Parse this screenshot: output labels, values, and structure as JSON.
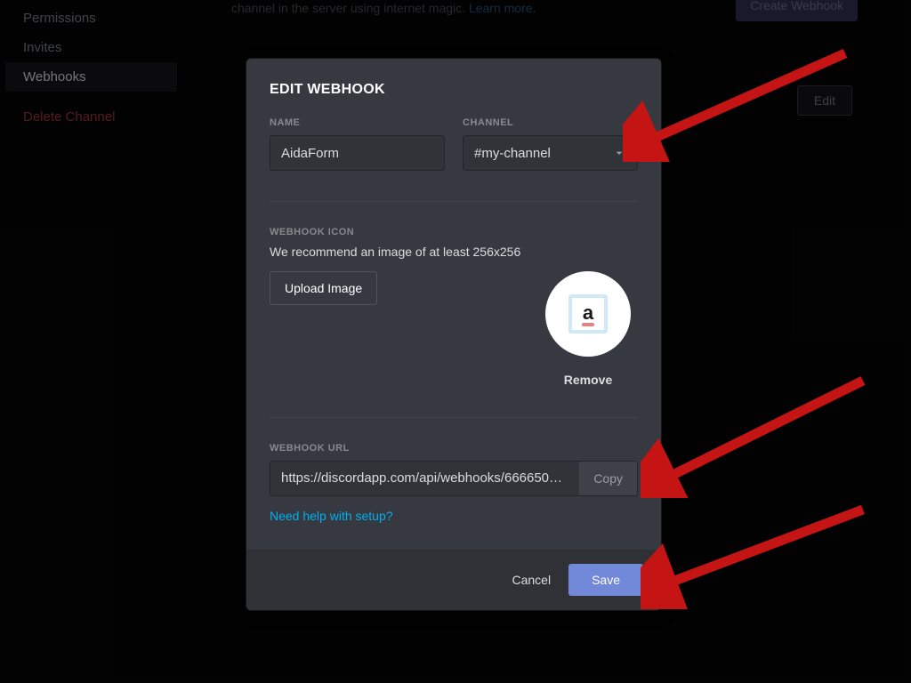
{
  "sidebar": {
    "items": [
      {
        "label": "Permissions"
      },
      {
        "label": "Invites"
      },
      {
        "label": "Webhooks"
      },
      {
        "label": "Delete Channel"
      }
    ]
  },
  "background": {
    "text_fragment": "channel in the server using internet magic. ",
    "learn_more": "Learn more.",
    "create_webhook": "Create Webhook",
    "edit": "Edit"
  },
  "modal": {
    "title": "EDIT WEBHOOK",
    "name_label": "NAME",
    "name_value": "AidaForm",
    "channel_label": "CHANNEL",
    "channel_value": "#my-channel",
    "icon_label": "WEBHOOK ICON",
    "icon_desc": "We recommend an image of at least 256x256",
    "upload_label": "Upload Image",
    "remove_label": "Remove",
    "url_label": "WEBHOOK URL",
    "url_value": "https://discordapp.com/api/webhooks/666650…",
    "copy_label": "Copy",
    "help_label": "Need help with setup?",
    "cancel_label": "Cancel",
    "save_label": "Save"
  }
}
